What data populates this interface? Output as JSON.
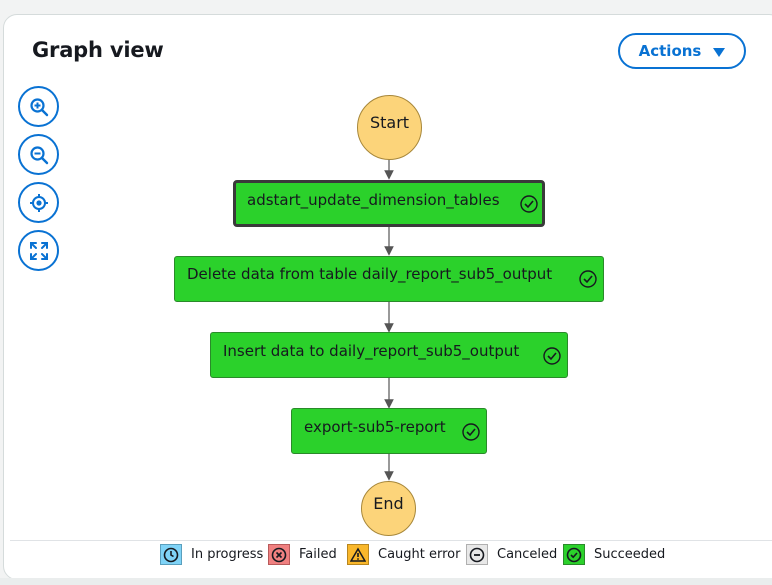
{
  "panel": {
    "title": "Graph view",
    "actions_label": "Actions"
  },
  "toolbar": [
    {
      "name": "zoom-in-button",
      "icon": "zoom-in-icon"
    },
    {
      "name": "zoom-out-button",
      "icon": "zoom-out-icon"
    },
    {
      "name": "center-button",
      "icon": "center-target-icon"
    },
    {
      "name": "fit-view-button",
      "icon": "expand-icon"
    }
  ],
  "graph": {
    "start_label": "Start",
    "end_label": "End",
    "states": [
      {
        "label": "adstart_update_dimension_tables",
        "status": "Succeeded",
        "selected": true
      },
      {
        "label": "Delete data from table daily_report_sub5_output",
        "status": "Succeeded",
        "selected": false
      },
      {
        "label": "Insert data to daily_report_sub5_output",
        "status": "Succeeded",
        "selected": false
      },
      {
        "label": "export-sub5-report",
        "status": "Succeeded",
        "selected": false
      }
    ]
  },
  "legend": [
    {
      "label": "In progress",
      "color": "#7fd3f7",
      "icon": "clock-icon"
    },
    {
      "label": "Failed",
      "color": "#f08080",
      "icon": "x-circle-icon"
    },
    {
      "label": "Caught error",
      "color": "#f9b72b",
      "icon": "warning-icon"
    },
    {
      "label": "Canceled",
      "color": "#e8e8e8",
      "icon": "minus-circle-icon"
    },
    {
      "label": "Succeeded",
      "color": "#2bd12b",
      "icon": "check-circle-icon"
    }
  ],
  "colors": {
    "accent": "#0972d3",
    "succeeded": "#2bd12b",
    "terminal_node": "#fcd47a"
  }
}
